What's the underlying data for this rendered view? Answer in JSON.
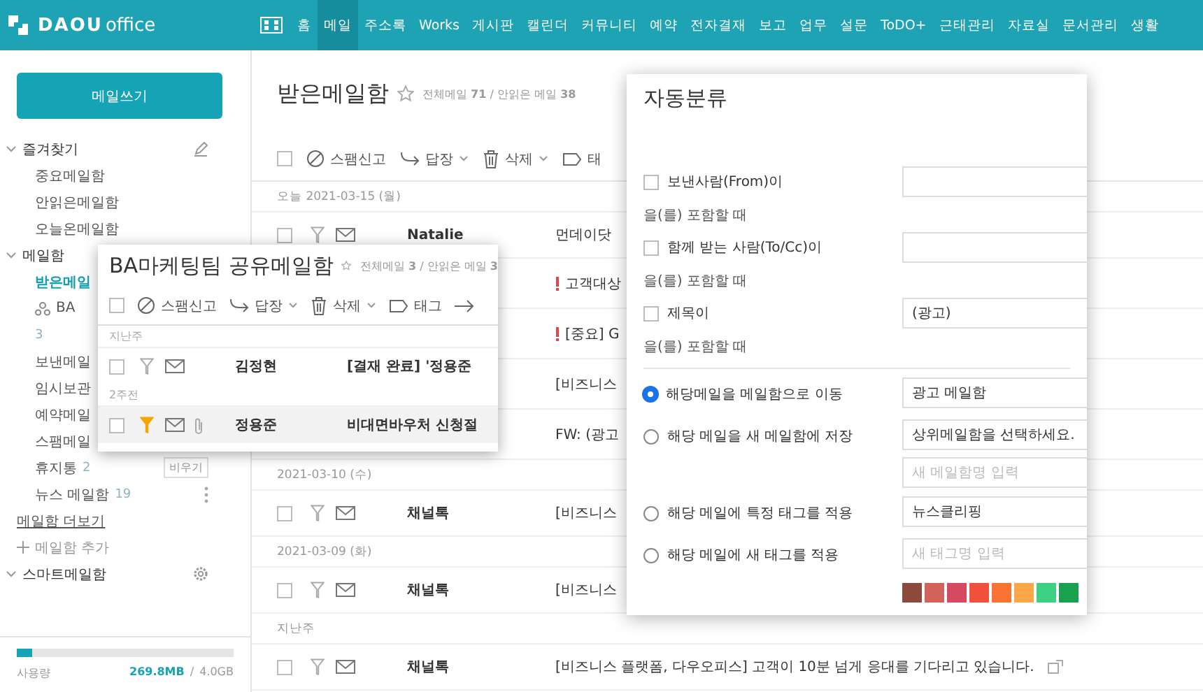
{
  "top_nav": {
    "logo": {
      "brand": "DAOU",
      "product": "office"
    },
    "items": [
      {
        "label": "홈",
        "selected": false
      },
      {
        "label": "메일",
        "selected": true
      },
      {
        "label": "주소록",
        "selected": false
      },
      {
        "label": "Works",
        "selected": false
      },
      {
        "label": "게시판",
        "selected": false
      },
      {
        "label": "캘린더",
        "selected": false
      },
      {
        "label": "커뮤니티",
        "selected": false
      },
      {
        "label": "예약",
        "selected": false
      },
      {
        "label": "전자결재",
        "selected": false
      },
      {
        "label": "보고",
        "selected": false
      },
      {
        "label": "업무",
        "selected": false
      },
      {
        "label": "설문",
        "selected": false
      },
      {
        "label": "ToDO+",
        "selected": false
      },
      {
        "label": "근태관리",
        "selected": false
      },
      {
        "label": "자료실",
        "selected": false
      },
      {
        "label": "문서관리",
        "selected": false
      },
      {
        "label": "생활",
        "selected": false
      }
    ]
  },
  "sidebar": {
    "compose_button": "메일쓰기",
    "sections": [
      {
        "title": "즐겨찾기",
        "kind": "editable",
        "expanded": true,
        "items": [
          {
            "label": "중요메일함",
            "kind": "folder",
            "selected": false
          },
          {
            "label": "안읽은메일함",
            "kind": "folder",
            "selected": false
          },
          {
            "label": "오늘온메일함",
            "kind": "folder",
            "selected": false
          }
        ]
      },
      {
        "title": "메일함",
        "kind": "plain",
        "expanded": true,
        "items": [
          {
            "label": "받은메일",
            "kind": "folder",
            "selected": true
          },
          {
            "label": "BA",
            "kind": "shared",
            "count": "3",
            "selected": false
          },
          {
            "label": "보낸메일",
            "kind": "folder",
            "selected": false
          },
          {
            "label": "임시보관",
            "kind": "folder",
            "selected": false
          },
          {
            "label": "예약메일",
            "kind": "folder",
            "selected": false
          },
          {
            "label": "스팸메일",
            "kind": "folder",
            "selected": false
          },
          {
            "label": "휴지통",
            "kind": "folder",
            "count": "2",
            "action": "비우기",
            "selected": false
          },
          {
            "label": "뉴스 메일함",
            "kind": "folder_menu",
            "count": "19",
            "selected": false
          }
        ],
        "more_link": "메일함 더보기",
        "add_label": "메일함 추가"
      },
      {
        "title": "스마트메일함",
        "kind": "settings",
        "expanded": true
      }
    ],
    "storage": {
      "label": "사용량",
      "used": "269.8MB",
      "separator": "/",
      "total": "4.0GB",
      "level": 0.07
    }
  },
  "mailbox": {
    "title": "받은메일함",
    "starred": false,
    "stats": "전체메일 **71** / 안읽은 메일 **38**",
    "all_checked": false,
    "toolbar": [
      {
        "kind": "spam",
        "label": "스팸신고",
        "dropdown": false
      },
      {
        "kind": "reply",
        "label": "답장",
        "dropdown": true
      },
      {
        "kind": "delete",
        "label": "삭제",
        "dropdown": true
      },
      {
        "kind": "tag",
        "label": "태",
        "dropdown": false
      }
    ],
    "list": [
      {
        "kind": "date",
        "label": "오늘 2021-03-15 (월)"
      },
      {
        "kind": "mail",
        "sender": "Natalie",
        "subject": "먼데이닷",
        "checked": false,
        "important": false,
        "flagged": false
      },
      {
        "kind": "subject_only",
        "subject": "고객대상",
        "important": true
      },
      {
        "kind": "subject_only",
        "subject": "[중요] G",
        "important": true
      },
      {
        "kind": "subject_only",
        "subject": "[비즈니스",
        "important": false
      },
      {
        "kind": "subject_only",
        "subject": "FW: (광고",
        "important": false
      },
      {
        "kind": "date",
        "label": "2021-03-10 (수)"
      },
      {
        "kind": "mail",
        "sender": "채널톡",
        "subject": "[비즈니스",
        "checked": false,
        "important": false,
        "flagged": false
      },
      {
        "kind": "date",
        "label": "2021-03-09 (화)"
      },
      {
        "kind": "mail",
        "sender": "채널톡",
        "subject": "[비즈니스",
        "checked": false,
        "important": false,
        "flagged": false
      },
      {
        "kind": "date",
        "label": "지난주"
      },
      {
        "kind": "mail",
        "sender": "채널톡",
        "subject": "[비즈니스 플랫폼, 다우오피스] 고객이 10분 넘게 응대를 기다리고 있습니다.",
        "checked": false,
        "important": false,
        "flagged": false,
        "popout": true
      }
    ]
  },
  "shared_mailbox_popup": {
    "title": "BA마케팅팀 공유메일함",
    "starred": false,
    "stats": "전체메일 **3** / 안읽은 메일 **3**",
    "all_checked": false,
    "toolbar": [
      {
        "kind": "spam",
        "label": "스팸신고",
        "dropdown": false
      },
      {
        "kind": "reply",
        "label": "답장",
        "dropdown": true
      },
      {
        "kind": "delete",
        "label": "삭제",
        "dropdown": true
      },
      {
        "kind": "tag",
        "label": "태그",
        "dropdown": false
      },
      {
        "kind": "move",
        "dropdown": false
      }
    ],
    "list": [
      {
        "kind": "date",
        "label": "지난주"
      },
      {
        "kind": "mail",
        "sender": "김정현",
        "subject": "[결재 완료] '정용준",
        "checked": false,
        "flagged": false,
        "attachment": false,
        "selected": false
      },
      {
        "kind": "date",
        "label": "2주전"
      },
      {
        "kind": "mail",
        "sender": "정용준",
        "subject": "비대면바우처 신청절",
        "checked": false,
        "flagged": true,
        "attachment": true,
        "selected": true
      }
    ]
  },
  "auto_sort_dialog": {
    "title": "자동분류",
    "conditions": [
      {
        "label": "보낸사람(From)이",
        "checked": false,
        "suffix": "을(를) 포함할 때"
      },
      {
        "label": "함께 받는 사람(To/Cc)이",
        "checked": false,
        "suffix": "을(를) 포함할 때"
      },
      {
        "label": "제목이",
        "checked": false,
        "value": "(광고)",
        "suffix": "을(를) 포함할 때"
      }
    ],
    "actions": [
      {
        "label": "해당메일을 메일함으로 이동",
        "selected": true,
        "fields": [
          {
            "kind": "select",
            "value": "광고 메일함"
          }
        ]
      },
      {
        "label": "해당 메일을 새 메일함에 저장",
        "selected": false,
        "fields": [
          {
            "kind": "select",
            "value": "상위메일함을 선택하세요."
          },
          {
            "kind": "input",
            "placeholder": "새 메일함명 입력"
          }
        ]
      },
      {
        "label": "해당 메일에 특정 태그를 적용",
        "selected": false,
        "fields": [
          {
            "kind": "select",
            "value": "뉴스클리핑"
          }
        ]
      },
      {
        "label": "해당 메일에 새 태그를 적용",
        "selected": false,
        "fields": [
          {
            "kind": "input",
            "placeholder": "새 태그명 입력"
          }
        ]
      }
    ],
    "tag_colors": [
      {
        "color": "#8b4a3c"
      },
      {
        "color": "#d0645a"
      },
      {
        "color": "#d54a62"
      },
      {
        "color": "#f0503c"
      },
      {
        "color": "#f97335"
      },
      {
        "color": "#fba84a"
      },
      {
        "color": "#3dcf83"
      },
      {
        "color": "#1aa150"
      }
    ]
  }
}
